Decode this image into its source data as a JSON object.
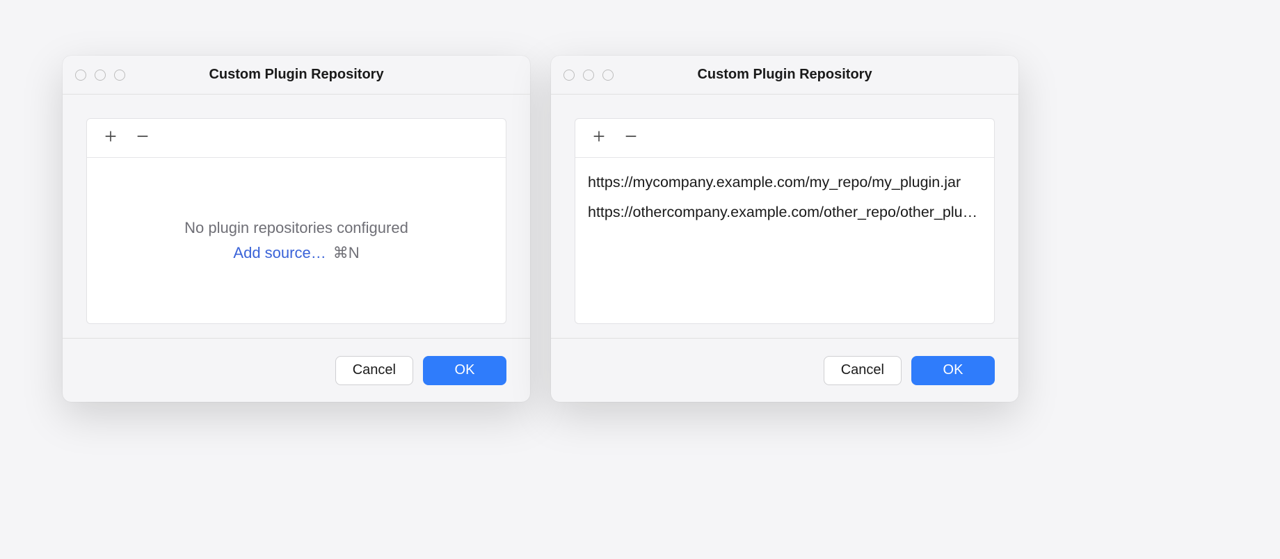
{
  "dialog1": {
    "title": "Custom Plugin Repository",
    "empty_message": "No plugin repositories configured",
    "add_source_label": "Add source…",
    "shortcut": "⌘N",
    "cancel_label": "Cancel",
    "ok_label": "OK"
  },
  "dialog2": {
    "title": "Custom Plugin Repository",
    "items": [
      "https://mycompany.example.com/my_repo/my_plugin.jar",
      "https://othercompany.example.com/other_repo/other_plugin.jar"
    ],
    "cancel_label": "Cancel",
    "ok_label": "OK"
  }
}
